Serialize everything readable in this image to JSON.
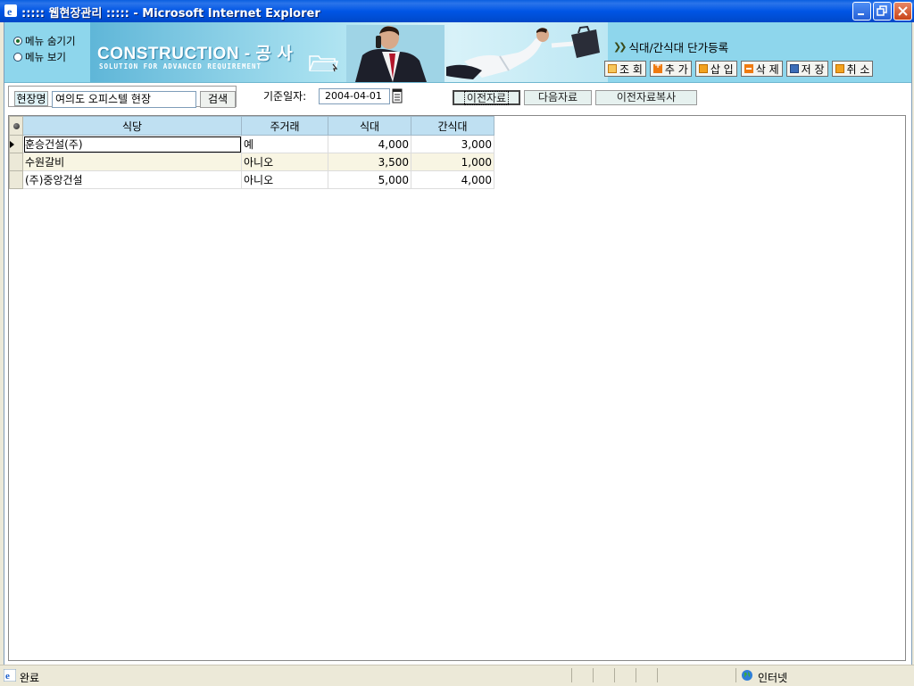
{
  "window": {
    "title": "::::: 웹현장관리 ::::: - Microsoft Internet Explorer"
  },
  "menu_toggle": {
    "hide_label": "메뉴 숨기기",
    "show_label": "메뉴 보기",
    "selected": "hide"
  },
  "banner": {
    "brand": "CONSTRUCTION - 공 사",
    "tagline": "SOLUTION FOR ADVANCED REQUIREMENT",
    "module_title": "식대/간식대 단가등록"
  },
  "toolbar": {
    "query": "조 회",
    "add": "추 가",
    "insert": "삽 입",
    "delete": "삭 제",
    "save": "저 장",
    "cancel": "취 소"
  },
  "filter": {
    "site_label": "현장명",
    "site_value": "여의도 오피스텔 현장",
    "search_button": "검색",
    "date_label": "기준일자:",
    "date_value": "2004-04-01",
    "prev_button": "이전자료",
    "next_button": "다음자료",
    "copy_button": "이전자료복사"
  },
  "grid": {
    "columns": [
      "식당",
      "주거래",
      "식대",
      "간식대"
    ],
    "rows": [
      {
        "restaurant": "훈승건설(주)",
        "main_trade": "예",
        "meal": "4,000",
        "snack": "3,000"
      },
      {
        "restaurant": "수원갈비",
        "main_trade": "아니오",
        "meal": "3,500",
        "snack": "1,000"
      },
      {
        "restaurant": "(주)중앙건설",
        "main_trade": "아니오",
        "meal": "5,000",
        "snack": "4,000"
      }
    ]
  },
  "statusbar": {
    "status": "완료",
    "zone": "인터넷"
  },
  "colors": {
    "banner_bg": "#8ed6ec",
    "grid_header": "#bfe0f2",
    "alt_row": "#f8f5e3",
    "titlebar": "#0055e5"
  }
}
